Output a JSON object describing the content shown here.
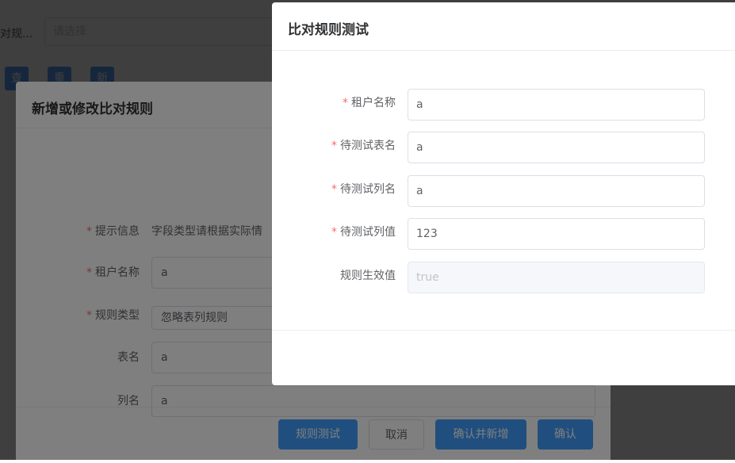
{
  "page": {
    "search_label": "对规...",
    "search_placeholder": "请选择",
    "buttons": {
      "query": "查询",
      "reset": "重置",
      "add": "新增"
    }
  },
  "dialog1": {
    "title": "新增或修改比对规则",
    "fields": {
      "hint": {
        "label": "提示信息",
        "value": "字段类型请根据实际情"
      },
      "tenant": {
        "label": "租户名称",
        "value": "a"
      },
      "rule_type": {
        "label": "规则类型",
        "value": "忽略表列规则"
      },
      "table": {
        "label": "表名",
        "value": "a"
      },
      "column": {
        "label": "列名",
        "value": "a"
      }
    },
    "footer": {
      "test": "规则测试",
      "cancel": "取消",
      "confirm_add": "确认并新增",
      "confirm": "确认"
    }
  },
  "dialog2": {
    "title": "比对规则测试",
    "fields": {
      "tenant": {
        "label": "租户名称",
        "value": "a"
      },
      "table": {
        "label": "待测试表名",
        "value": "a"
      },
      "column": {
        "label": "待测试列名",
        "value": "a"
      },
      "column_value": {
        "label": "待测试列值",
        "value": "123"
      },
      "effective": {
        "label": "规则生效值",
        "placeholder": "true"
      }
    }
  },
  "colors": {
    "primary": "#409eff",
    "required": "#f56c6c",
    "overlay": "rgba(0,0,0,0.5)"
  }
}
